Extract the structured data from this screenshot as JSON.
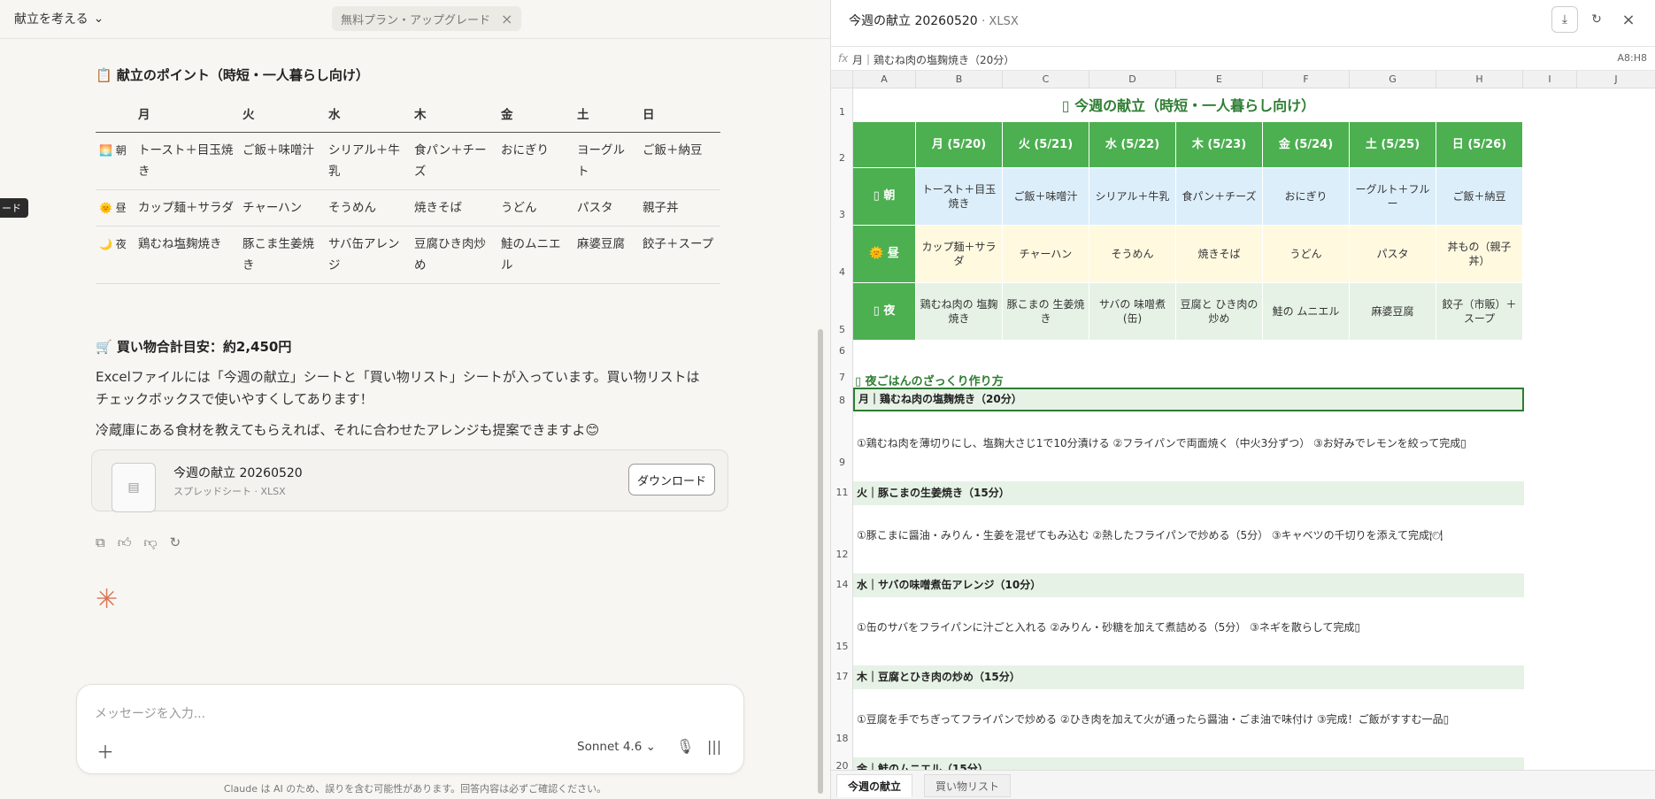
{
  "left": {
    "project": "献立を考える",
    "plan_badge": "無料プラン・アップグレード",
    "tooltip": "ード",
    "points_heading": "📋 献立のポイント（時短・一人暮らし向け）",
    "days": [
      "月",
      "火",
      "水",
      "木",
      "金",
      "土",
      "日"
    ],
    "rows": [
      {
        "label": "🌅 朝",
        "items": [
          "トースト＋目玉焼き",
          "ご飯＋味噌汁",
          "シリアル＋牛乳",
          "食パン＋チーズ",
          "おにぎり",
          "ヨーグルト",
          "ご飯＋納豆"
        ]
      },
      {
        "label": "🌞 昼",
        "items": [
          "カップ麺＋サラダ",
          "チャーハン",
          "そうめん",
          "焼きそば",
          "うどん",
          "パスタ",
          "親子丼"
        ]
      },
      {
        "label": "🌙 夜",
        "items": [
          "鶏むね塩麹焼き",
          "豚こま生姜焼き",
          "サバ缶アレンジ",
          "豆腐ひき肉炒め",
          "鮭のムニエル",
          "麻婆豆腐",
          "餃子＋スープ"
        ]
      }
    ],
    "shopping_heading": "🛒 買い物合計目安：約2,450円",
    "para1": "Excelファイルには「今週の献立」シートと「買い物リスト」シートが入っています。買い物リストはチェックボックスで使いやすくしてあります！",
    "para2": "冷蔵庫にある食材を教えてもらえれば、それに合わせたアレンジも提案できますよ😊",
    "file": {
      "name": "今週の献立 20260520",
      "sub": "スプレッドシート · XLSX",
      "download": "ダウンロード"
    },
    "input_placeholder": "メッセージを入力...",
    "model": "Sonnet 4.6",
    "disclaimer": "Claude は AI のため、誤りを含む可能性があります。回答内容は必ずご確認ください。"
  },
  "right": {
    "title": "今週の献立 20260520",
    "ext": "· XLSX",
    "formula": "月｜鶏むね肉の塩麹焼き（20分）",
    "cell_ref": "A8:H8",
    "cols": [
      "A",
      "B",
      "C",
      "D",
      "E",
      "F",
      "G",
      "H",
      "I",
      "J"
    ],
    "sheet_title": "▯ 今週の献立（時短・一人暮らし向け）",
    "day_headers": [
      "月 (5/20)",
      "火 (5/21)",
      "水 (5/22)",
      "木 (5/23)",
      "金 (5/24)",
      "土 (5/25)",
      "日 (5/26)"
    ],
    "meal_rows": [
      {
        "label": "▯ 朝",
        "items": [
          "トースト＋目玉焼き",
          "ご飯＋味噌汁",
          "シリアル＋牛乳",
          "食パン＋チーズ",
          "おにぎり",
          "ーグルト＋フルー",
          "ご飯＋納豆"
        ]
      },
      {
        "label": "🌞 昼",
        "items": [
          "カップ麺＋サラダ",
          "チャーハン",
          "そうめん",
          "焼きそば",
          "うどん",
          "パスタ",
          "丼もの（親子丼）"
        ]
      },
      {
        "label": "▯ 夜",
        "items": [
          "鶏むね肉の 塩麹焼き",
          "豚こまの 生姜焼き",
          "サバの 味噌煮(缶)",
          "豆腐と ひき肉の炒め",
          "鮭の ムニエル",
          "麻婆豆腐",
          "餃子（市販）＋スープ"
        ]
      }
    ],
    "section": "▯ 夜ごはんのざっくり作り方",
    "recipes": [
      {
        "row": "8",
        "title": "月｜鶏むね肉の塩麹焼き（20分）",
        "step_row": "9",
        "steps": "①鶏むね肉を薄切りにし、塩麹大さじ1で10分漬ける ②フライパンで両面焼く（中火3分ずつ） ③お好みでレモンを絞って完成▯"
      },
      {
        "row": "11",
        "title": "火｜豚こまの生姜焼き（15分）",
        "step_row": "12",
        "steps": "①豚こまに醤油・みりん・生姜を混ぜてもみ込む ②熱したフライパンで炒める（5分） ③キャベツの千切りを添えて完成🍽"
      },
      {
        "row": "14",
        "title": "水｜サバの味噌煮缶アレンジ（10分）",
        "step_row": "15",
        "steps": "①缶のサバをフライパンに汁ごと入れる ②みりん・砂糖を加えて煮詰める（5分） ③ネギを散らして完成▯"
      },
      {
        "row": "17",
        "title": "木｜豆腐とひき肉の炒め（15分）",
        "step_row": "18",
        "steps": "①豆腐を手でちぎってフライパンで炒める ②ひき肉を加えて火が通ったら醤油・ごま油で味付け ③完成！ご飯がすすむ一品▯"
      },
      {
        "row": "20",
        "title": "金｜鮭のムニエル（15分）"
      }
    ],
    "tabs": [
      "今週の献立",
      "買い物リスト"
    ]
  },
  "colors": {
    "green": "#4caf50",
    "dark_green": "#2e7d32",
    "morning": "#ddeefb",
    "noon": "#fff9e0",
    "night": "#e6f2e6",
    "accent": "#d97757"
  }
}
